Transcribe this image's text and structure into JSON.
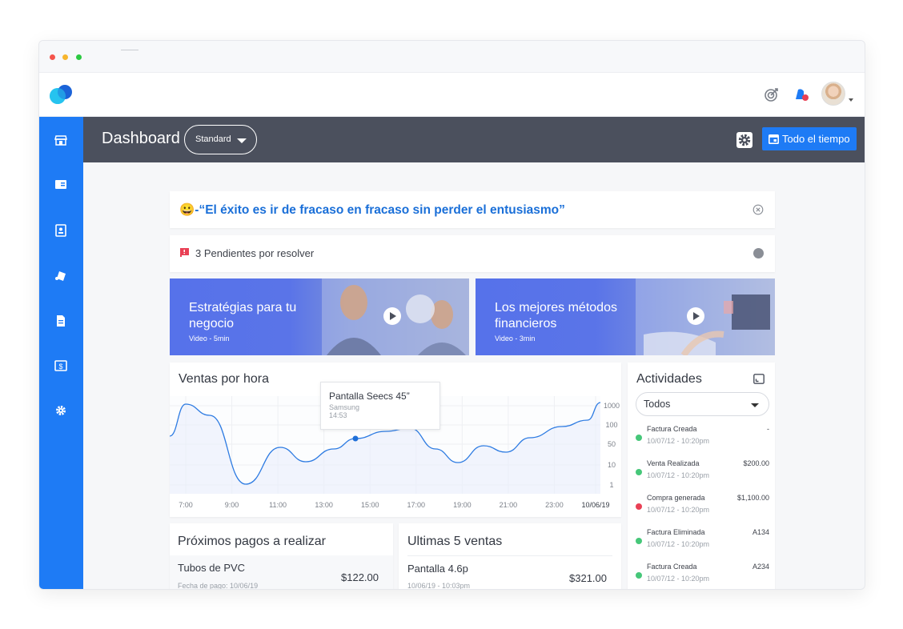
{
  "window": {
    "title": ""
  },
  "header": {
    "title": "Dashboard",
    "view_select": "Standard",
    "time_button": "Todo el tiempo"
  },
  "quote": {
    "text": "😀-“El éxito es ir de fracaso en fracaso sin perder el entusiasmo”"
  },
  "pending": {
    "text": "3 Pendientes por resolver"
  },
  "banners": [
    {
      "title": "Estratégias para tu negocio",
      "sub": "Video - 5min"
    },
    {
      "title": "Los mejores métodos financieros",
      "sub": "Video - 3min"
    }
  ],
  "chart": {
    "title": "Ventas por hora",
    "tooltip": {
      "title": "Pantalla Seecs 45”",
      "brand": "Samsung",
      "time": "14:53"
    },
    "x_labels": [
      "7:00",
      "9:00",
      "11:00",
      "13:00",
      "15:00",
      "17:00",
      "19:00",
      "21:00",
      "23:00",
      "10/06/19"
    ],
    "y_labels": [
      "1000",
      "100",
      "50",
      "10",
      "1"
    ]
  },
  "chart_data": {
    "type": "area",
    "title": "Ventas por hora",
    "categories": [
      "7:00",
      "9:00",
      "11:00",
      "13:00",
      "15:00",
      "17:00",
      "19:00",
      "21:00",
      "23:00",
      "10/06/19"
    ],
    "y_ticks": [
      "1",
      "10",
      "50",
      "100",
      "1000"
    ],
    "y_scale": "log",
    "series": [
      {
        "values": [
          50,
          1000,
          1,
          1,
          50,
          10,
          50,
          100,
          100,
          1000
        ]
      }
    ],
    "highlight": {
      "x": "15:00",
      "label": "Pantalla Seecs 45”",
      "sub": "Samsung",
      "time": "14:53"
    },
    "grid": true
  },
  "payments": {
    "title": "Próximos pagos a realizar",
    "items": [
      {
        "name": "Tubos de PVC",
        "date": "Fecha de pago: 10/06/19",
        "amount": "$122.00"
      }
    ]
  },
  "sales": {
    "title": "Ultimas 5 ventas",
    "items": [
      {
        "name": "Pantalla 4.6p",
        "date": "10/06/19 - 10:03pm",
        "amount": "$321.00"
      }
    ]
  },
  "activities": {
    "title": "Actividades",
    "filter": "Todos",
    "items": [
      {
        "label": "Factura Creada",
        "time": "10/07/12 - 10:20pm",
        "amount": "-",
        "color": "#46c779"
      },
      {
        "label": "Venta Realizada",
        "time": "10/07/12 - 10:20pm",
        "amount": "$200.00",
        "color": "#46c779"
      },
      {
        "label": "Compra generada",
        "time": "10/07/12 - 10:20pm",
        "amount": "$1,100.00",
        "color": "#e94055"
      },
      {
        "label": "Factura Eliminada",
        "time": "10/07/12 - 10:20pm",
        "amount": "A134",
        "color": "#46c779"
      },
      {
        "label": "Factura Creada",
        "time": "10/07/12 - 10:20pm",
        "amount": "A234",
        "color": "#46c779"
      }
    ]
  },
  "colors": {
    "accent": "#1e7bf5",
    "header": "#4b505d",
    "sidebar": "#1e7bf5"
  },
  "icons": {
    "sidebar": [
      "store-icon",
      "card-icon",
      "contact-icon",
      "apps-icon",
      "document-icon",
      "money-icon",
      "settings-icon"
    ],
    "topbar": [
      "target-icon",
      "notification-icon",
      "avatar"
    ]
  }
}
